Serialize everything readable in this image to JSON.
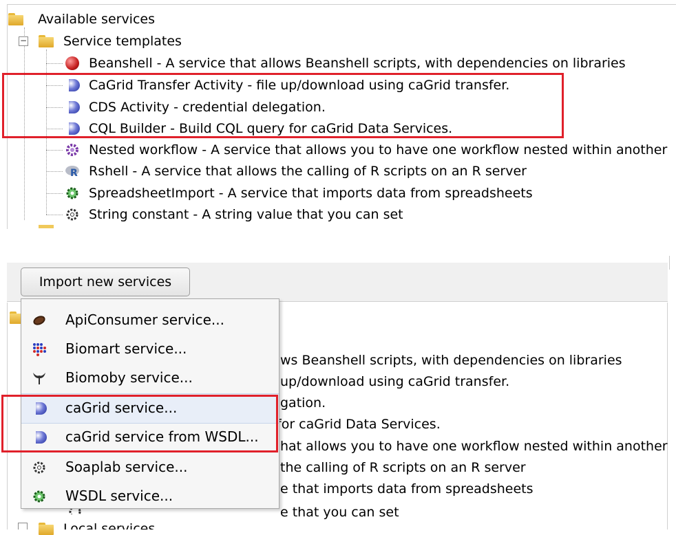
{
  "tree_top": {
    "root_label": "Available services",
    "group_label": "Service templates",
    "items": [
      {
        "label": "Beanshell - A service that allows Beanshell scripts, with dependencies on libraries"
      },
      {
        "label": "CaGrid Transfer Activity - file up/download using caGrid transfer."
      },
      {
        "label": "CDS Activity - credential delegation."
      },
      {
        "label": "CQL Builder - Build CQL query for caGrid Data Services."
      },
      {
        "label": "Nested workflow - A service that allows you to have one workflow nested within another"
      },
      {
        "label": "Rshell - A service that allows the calling of R scripts on an R server"
      },
      {
        "label": "SpreadsheetImport - A service that imports data from spreadsheets"
      },
      {
        "label": "String constant - A string value that you can set"
      }
    ]
  },
  "toolbar": {
    "import_button_label": "Import new services"
  },
  "import_menu": {
    "items": [
      {
        "label": "ApiConsumer service...",
        "icon": "coffee-bean-icon"
      },
      {
        "label": "Biomart service...",
        "icon": "biomart-dots-icon"
      },
      {
        "label": "Biomoby service...",
        "icon": "whale-tail-icon"
      },
      {
        "label": "caGrid service...",
        "icon": "cagrid-hemisphere-icon"
      },
      {
        "label": "caGrid service from WSDL...",
        "icon": "cagrid-hemisphere-icon"
      },
      {
        "label": "Soaplab service...",
        "icon": "gear-outline-icon"
      },
      {
        "label": "WSDL service...",
        "icon": "gear-green-icon"
      }
    ]
  },
  "tree_bottom_partial": {
    "lines": [
      "ws Beanshell scripts, with dependencies on libraries",
      "up/download using caGrid transfer.",
      "gation.",
      " for caGrid Data Services.",
      "hat allows you to have one workflow nested within another",
      "the calling of R scripts on an R server",
      "e that imports data from spreadsheets",
      "e that you can set"
    ],
    "cut_label": "Local services"
  },
  "colors": {
    "highlight": "#e0202a",
    "cagrid_blue": "#1c2a9a",
    "gear_green": "#2e8b2e"
  }
}
